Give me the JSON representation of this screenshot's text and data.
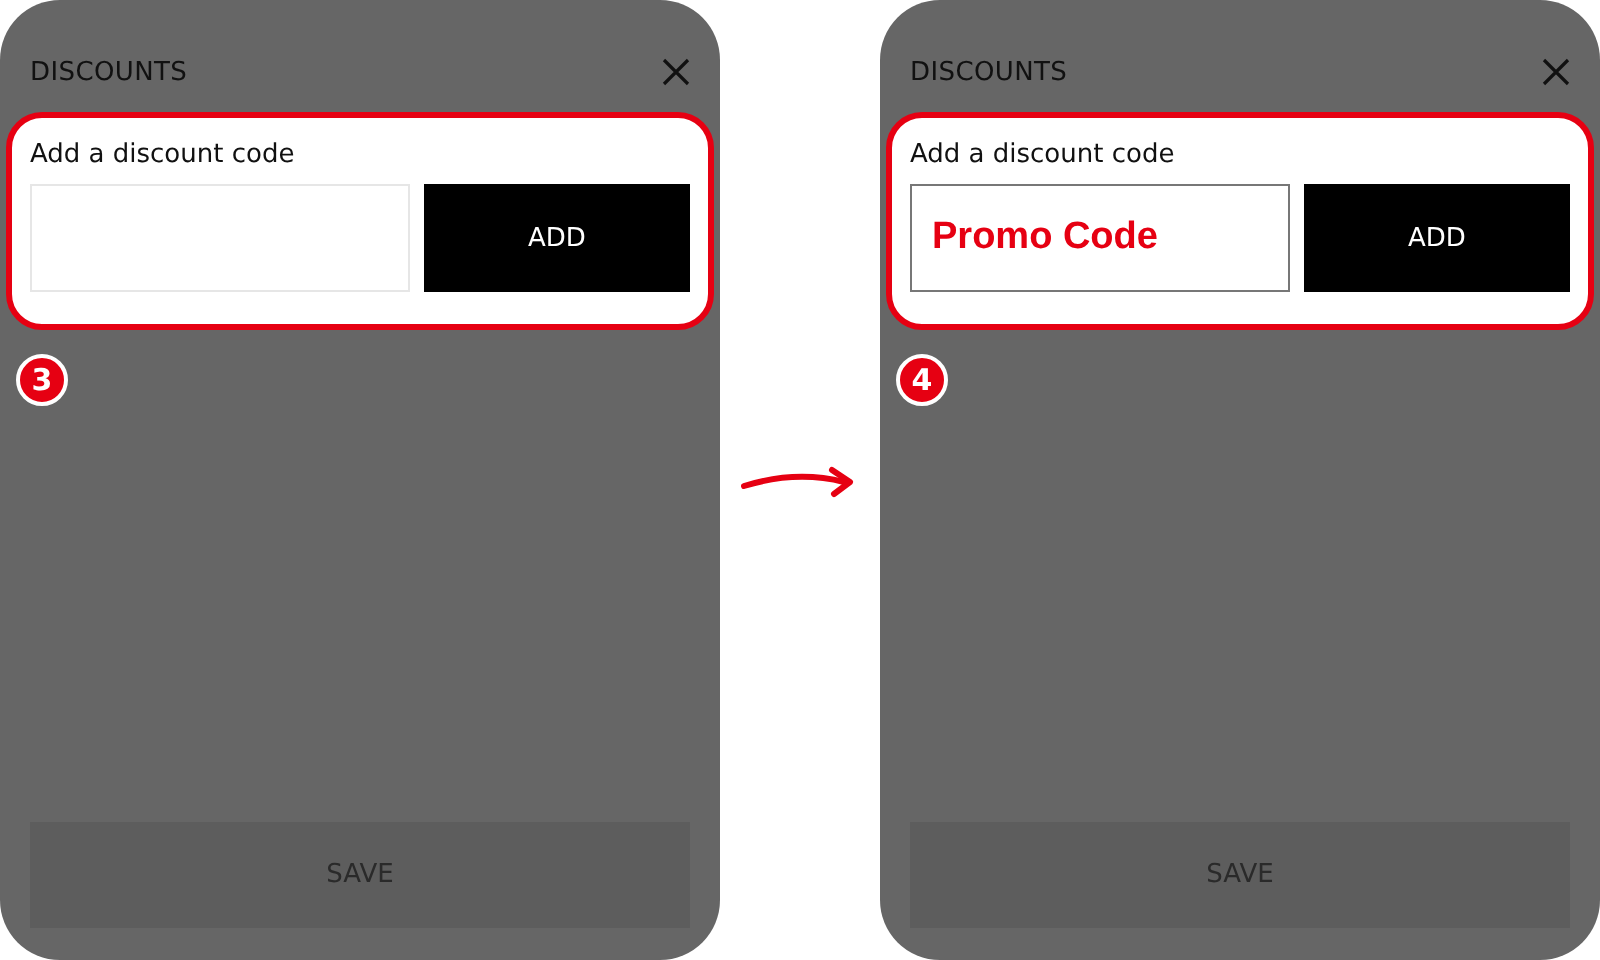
{
  "screens": [
    {
      "title": "DISCOUNTS",
      "field_label": "Add a discount code",
      "focused": false,
      "add_button": "ADD",
      "step": "3",
      "save_button": "SAVE"
    },
    {
      "title": "DISCOUNTS",
      "field_label": "Add a discount code",
      "field_value": "Promo Code",
      "focused": true,
      "add_button": "ADD",
      "step": "4",
      "save_button": "SAVE"
    }
  ]
}
